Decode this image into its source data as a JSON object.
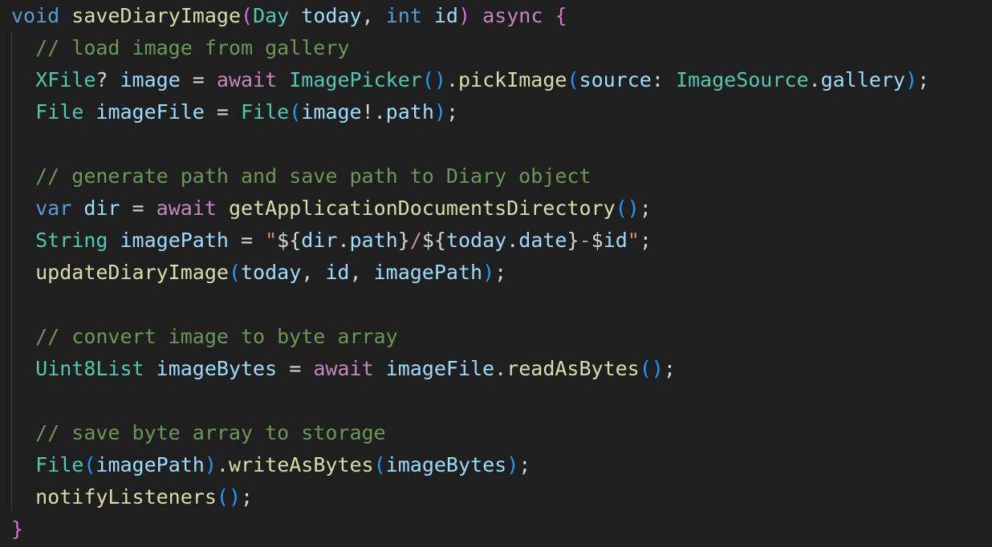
{
  "editor": {
    "theme": {
      "background": "#1f1f1f",
      "default_text": "#d4d4d4",
      "keyword_control": "#c586c0",
      "keyword_type": "#569cd6",
      "type_name": "#4ec9b0",
      "function": "#dcdcaa",
      "variable": "#9cdcfe",
      "comment": "#6a9955",
      "string": "#ce9178",
      "bracket_level_1": "#da70d6",
      "bracket_level_2": "#179fff",
      "bracket_level_3": "#ffd700"
    },
    "lines": [
      {
        "text": "void saveDiaryImage(Day today, int id) async {",
        "tokens": [
          {
            "t": "void",
            "k": "type-kw"
          },
          {
            "t": " ",
            "k": "pun"
          },
          {
            "t": "saveDiaryImage",
            "k": "fn"
          },
          {
            "t": "(",
            "k": "br1"
          },
          {
            "t": "Day",
            "k": "type"
          },
          {
            "t": " ",
            "k": "pun"
          },
          {
            "t": "today",
            "k": "prm"
          },
          {
            "t": ", ",
            "k": "pun"
          },
          {
            "t": "int",
            "k": "type-kw"
          },
          {
            "t": " ",
            "k": "pun"
          },
          {
            "t": "id",
            "k": "prm"
          },
          {
            "t": ")",
            "k": "br1"
          },
          {
            "t": " ",
            "k": "pun"
          },
          {
            "t": "async",
            "k": "kw"
          },
          {
            "t": " ",
            "k": "pun"
          },
          {
            "t": "{",
            "k": "br1"
          }
        ]
      },
      {
        "text": "  // load image from gallery",
        "tokens": [
          {
            "t": "  ",
            "k": "pun"
          },
          {
            "t": "// load image from gallery",
            "k": "cmt"
          }
        ]
      },
      {
        "text": "  XFile? image = await ImagePicker().pickImage(source: ImageSource.gallery);",
        "tokens": [
          {
            "t": "  ",
            "k": "pun"
          },
          {
            "t": "XFile",
            "k": "type"
          },
          {
            "t": "? ",
            "k": "pun"
          },
          {
            "t": "image",
            "k": "var"
          },
          {
            "t": " = ",
            "k": "pun"
          },
          {
            "t": "await",
            "k": "kw"
          },
          {
            "t": " ",
            "k": "pun"
          },
          {
            "t": "ImagePicker",
            "k": "type"
          },
          {
            "t": "()",
            "k": "br2"
          },
          {
            "t": ".",
            "k": "pun"
          },
          {
            "t": "pickImage",
            "k": "fn"
          },
          {
            "t": "(",
            "k": "br2"
          },
          {
            "t": "source",
            "k": "var"
          },
          {
            "t": ": ",
            "k": "pun"
          },
          {
            "t": "ImageSource",
            "k": "type"
          },
          {
            "t": ".",
            "k": "pun"
          },
          {
            "t": "gallery",
            "k": "var"
          },
          {
            "t": ")",
            "k": "br2"
          },
          {
            "t": ";",
            "k": "pun"
          }
        ]
      },
      {
        "text": "  File imageFile = File(image!.path);",
        "tokens": [
          {
            "t": "  ",
            "k": "pun"
          },
          {
            "t": "File",
            "k": "type"
          },
          {
            "t": " ",
            "k": "pun"
          },
          {
            "t": "imageFile",
            "k": "var"
          },
          {
            "t": " = ",
            "k": "pun"
          },
          {
            "t": "File",
            "k": "type"
          },
          {
            "t": "(",
            "k": "br2"
          },
          {
            "t": "image",
            "k": "var"
          },
          {
            "t": "!.",
            "k": "pun"
          },
          {
            "t": "path",
            "k": "var"
          },
          {
            "t": ")",
            "k": "br2"
          },
          {
            "t": ";",
            "k": "pun"
          }
        ]
      },
      {
        "text": "",
        "tokens": []
      },
      {
        "text": "  // generate path and save path to Diary object",
        "tokens": [
          {
            "t": "  ",
            "k": "pun"
          },
          {
            "t": "// generate path and save path to Diary object",
            "k": "cmt"
          }
        ]
      },
      {
        "text": "  var dir = await getApplicationDocumentsDirectory();",
        "tokens": [
          {
            "t": "  ",
            "k": "pun"
          },
          {
            "t": "var",
            "k": "type-kw"
          },
          {
            "t": " ",
            "k": "pun"
          },
          {
            "t": "dir",
            "k": "var"
          },
          {
            "t": " = ",
            "k": "pun"
          },
          {
            "t": "await",
            "k": "kw"
          },
          {
            "t": " ",
            "k": "pun"
          },
          {
            "t": "getApplicationDocumentsDirectory",
            "k": "fn"
          },
          {
            "t": "()",
            "k": "br2"
          },
          {
            "t": ";",
            "k": "pun"
          }
        ]
      },
      {
        "text": "  String imagePath = \"${dir.path}/${today.date}-$id\";",
        "tokens": [
          {
            "t": "  ",
            "k": "pun"
          },
          {
            "t": "String",
            "k": "type"
          },
          {
            "t": " ",
            "k": "pun"
          },
          {
            "t": "imagePath",
            "k": "var"
          },
          {
            "t": " = ",
            "k": "pun"
          },
          {
            "t": "\"",
            "k": "str"
          },
          {
            "t": "${",
            "k": "pun"
          },
          {
            "t": "dir",
            "k": "var"
          },
          {
            "t": ".",
            "k": "pun"
          },
          {
            "t": "path",
            "k": "var"
          },
          {
            "t": "}",
            "k": "pun"
          },
          {
            "t": "/",
            "k": "str"
          },
          {
            "t": "${",
            "k": "pun"
          },
          {
            "t": "today",
            "k": "var"
          },
          {
            "t": ".",
            "k": "pun"
          },
          {
            "t": "date",
            "k": "var"
          },
          {
            "t": "}",
            "k": "pun"
          },
          {
            "t": "-",
            "k": "str"
          },
          {
            "t": "$",
            "k": "pun"
          },
          {
            "t": "id",
            "k": "var"
          },
          {
            "t": "\"",
            "k": "str"
          },
          {
            "t": ";",
            "k": "pun"
          }
        ]
      },
      {
        "text": "  updateDiaryImage(today, id, imagePath);",
        "tokens": [
          {
            "t": "  ",
            "k": "pun"
          },
          {
            "t": "updateDiaryImage",
            "k": "fn"
          },
          {
            "t": "(",
            "k": "br2"
          },
          {
            "t": "today",
            "k": "var"
          },
          {
            "t": ", ",
            "k": "pun"
          },
          {
            "t": "id",
            "k": "var"
          },
          {
            "t": ", ",
            "k": "pun"
          },
          {
            "t": "imagePath",
            "k": "var"
          },
          {
            "t": ")",
            "k": "br2"
          },
          {
            "t": ";",
            "k": "pun"
          }
        ]
      },
      {
        "text": "",
        "tokens": []
      },
      {
        "text": "  // convert image to byte array",
        "tokens": [
          {
            "t": "  ",
            "k": "pun"
          },
          {
            "t": "// convert image to byte array",
            "k": "cmt"
          }
        ]
      },
      {
        "text": "  Uint8List imageBytes = await imageFile.readAsBytes();",
        "tokens": [
          {
            "t": "  ",
            "k": "pun"
          },
          {
            "t": "Uint8List",
            "k": "type"
          },
          {
            "t": " ",
            "k": "pun"
          },
          {
            "t": "imageBytes",
            "k": "var"
          },
          {
            "t": " = ",
            "k": "pun"
          },
          {
            "t": "await",
            "k": "kw"
          },
          {
            "t": " ",
            "k": "pun"
          },
          {
            "t": "imageFile",
            "k": "var"
          },
          {
            "t": ".",
            "k": "pun"
          },
          {
            "t": "readAsBytes",
            "k": "fn"
          },
          {
            "t": "()",
            "k": "br2"
          },
          {
            "t": ";",
            "k": "pun"
          }
        ]
      },
      {
        "text": "",
        "tokens": []
      },
      {
        "text": "  // save byte array to storage",
        "tokens": [
          {
            "t": "  ",
            "k": "pun"
          },
          {
            "t": "// save byte array to storage",
            "k": "cmt"
          }
        ]
      },
      {
        "text": "  File(imagePath).writeAsBytes(imageBytes);",
        "tokens": [
          {
            "t": "  ",
            "k": "pun"
          },
          {
            "t": "File",
            "k": "type"
          },
          {
            "t": "(",
            "k": "br2"
          },
          {
            "t": "imagePath",
            "k": "var"
          },
          {
            "t": ")",
            "k": "br2"
          },
          {
            "t": ".",
            "k": "pun"
          },
          {
            "t": "writeAsBytes",
            "k": "fn"
          },
          {
            "t": "(",
            "k": "br2"
          },
          {
            "t": "imageBytes",
            "k": "var"
          },
          {
            "t": ")",
            "k": "br2"
          },
          {
            "t": ";",
            "k": "pun"
          }
        ]
      },
      {
        "text": "  notifyListeners();",
        "tokens": [
          {
            "t": "  ",
            "k": "pun"
          },
          {
            "t": "notifyListeners",
            "k": "fn"
          },
          {
            "t": "()",
            "k": "br2"
          },
          {
            "t": ";",
            "k": "pun"
          }
        ]
      },
      {
        "text": "}",
        "tokens": [
          {
            "t": "}",
            "k": "br1"
          }
        ]
      }
    ]
  }
}
